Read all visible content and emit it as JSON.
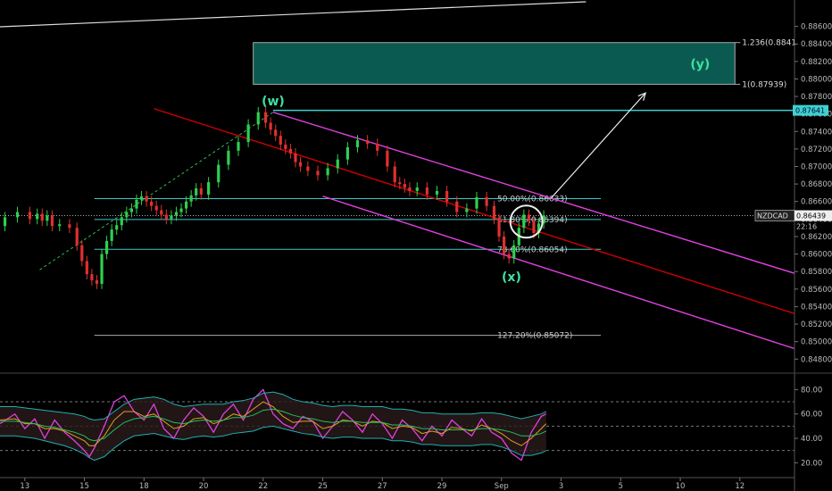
{
  "chart_data": {
    "type": "line",
    "symbol": "NZDCAD",
    "last_price": "0.86439",
    "countdown": "22:16",
    "price_axis": {
      "ylim": [
        0.8466,
        0.8882
      ],
      "ticks": [
        "0.88600",
        "0.88400",
        "0.88200",
        "0.88000",
        "0.87800",
        "0.87600",
        "0.87400",
        "0.87200",
        "0.87000",
        "0.86800",
        "0.86600",
        "0.86400",
        "0.86200",
        "0.86000",
        "0.85800",
        "0.85600",
        "0.85400",
        "0.85200",
        "0.85000",
        "0.84800"
      ],
      "tick_values": [
        0.886,
        0.884,
        0.882,
        0.88,
        0.878,
        0.876,
        0.874,
        0.872,
        0.87,
        0.868,
        0.866,
        0.864,
        0.862,
        0.86,
        0.858,
        0.856,
        0.854,
        0.852,
        0.85,
        0.848
      ]
    },
    "x_axis": {
      "ticks": [
        "13",
        "15",
        "18",
        "20",
        "22",
        "25",
        "27",
        "29",
        "Sep",
        "3",
        "5",
        "10",
        "12"
      ],
      "tick_positions": [
        0,
        12,
        24,
        36,
        48,
        60,
        72,
        84,
        96,
        108,
        120,
        132,
        144
      ],
      "xlim": [
        -5,
        155
      ]
    },
    "wave_labels": [
      {
        "text": "(w)",
        "x": 50,
        "y": 0.877
      },
      {
        "text": "(x)",
        "x": 98,
        "y": 0.8569
      },
      {
        "text": "(y)",
        "x": 136,
        "y": 0.8812
      }
    ],
    "target_box": {
      "x_start": 46,
      "x_end": 143,
      "y_low": 0.87939,
      "y_high": 0.88415,
      "labels": [
        "1.236(0.8841",
        "1(0.87939)"
      ]
    },
    "resistance_level": {
      "value": 0.87641,
      "label": "0.87641"
    },
    "fib_levels": [
      {
        "label": "50.00%(0.86633)",
        "value": 0.86633,
        "x_start": 14,
        "x_end": 116
      },
      {
        "label": "61.80%(0.86394)",
        "value": 0.86394,
        "x_start": 14,
        "x_end": 116
      },
      {
        "label": "78.60%(0.86054)",
        "value": 0.86054,
        "x_start": 14,
        "x_end": 116
      },
      {
        "label": "127.20%(0.85072)",
        "value": 0.85072,
        "x_start": 14,
        "x_end": 116
      }
    ],
    "channel_lines": [
      {
        "color": "#e040e0",
        "points": [
          [
            50,
            0.8762
          ],
          [
            155,
            0.8578
          ]
        ]
      },
      {
        "color": "#e040e0",
        "points": [
          [
            60,
            0.8666
          ],
          [
            155,
            0.8492
          ]
        ]
      },
      {
        "color": "#cc0000",
        "points": [
          [
            26,
            0.8766
          ],
          [
            155,
            0.8532
          ]
        ]
      }
    ],
    "arrow": {
      "from": [
        106,
        0.8664
      ],
      "to": [
        125,
        0.8784
      ]
    },
    "dotted_trend": {
      "from": [
        3,
        0.8582
      ],
      "to": [
        50,
        0.8762
      ]
    },
    "price_series": {
      "x": [
        -5,
        -3,
        0,
        2,
        3,
        4,
        5,
        6,
        8,
        10,
        11,
        12,
        13,
        14,
        15,
        16,
        17,
        18,
        19,
        20,
        21,
        22,
        23,
        24,
        25,
        26,
        27,
        28,
        29,
        30,
        31,
        32,
        33,
        34,
        35,
        36,
        38,
        40,
        42,
        44,
        46,
        48,
        49,
        50,
        51,
        52,
        53,
        54,
        55,
        56,
        58,
        60,
        62,
        64,
        66,
        68,
        70,
        72,
        74,
        75,
        76,
        77,
        78,
        80,
        82,
        84,
        86,
        88,
        90,
        92,
        94,
        95,
        96,
        97,
        98,
        99,
        100,
        101,
        102,
        103,
        104,
        105
      ],
      "y": [
        0.8632,
        0.8642,
        0.8648,
        0.864,
        0.8646,
        0.8638,
        0.8644,
        0.8632,
        0.8634,
        0.863,
        0.861,
        0.8592,
        0.8577,
        0.857,
        0.8566,
        0.86,
        0.8615,
        0.8628,
        0.8633,
        0.8642,
        0.8648,
        0.8652,
        0.8662,
        0.8666,
        0.866,
        0.8655,
        0.865,
        0.8645,
        0.864,
        0.8644,
        0.8648,
        0.8652,
        0.866,
        0.8667,
        0.8675,
        0.8668,
        0.8682,
        0.8702,
        0.8718,
        0.8728,
        0.8748,
        0.8762,
        0.875,
        0.8742,
        0.8735,
        0.8725,
        0.872,
        0.8715,
        0.8705,
        0.87,
        0.8695,
        0.869,
        0.8698,
        0.8708,
        0.8722,
        0.873,
        0.8726,
        0.8718,
        0.87,
        0.8682,
        0.868,
        0.8676,
        0.8672,
        0.8676,
        0.8668,
        0.8672,
        0.866,
        0.8648,
        0.8652,
        0.8665,
        0.8655,
        0.864,
        0.862,
        0.86,
        0.8595,
        0.861,
        0.863,
        0.8645,
        0.8638,
        0.8624,
        0.8635,
        0.8644
      ]
    },
    "oscillator": {
      "ylim": [
        10,
        92
      ],
      "ticks": [
        "80.00",
        "60.00",
        "40.00",
        "20.00"
      ],
      "tick_values": [
        80,
        60,
        40,
        20
      ],
      "levels": [
        70,
        50,
        30
      ],
      "x": [
        -5,
        -2,
        0,
        2,
        4,
        6,
        8,
        10,
        12,
        13,
        14,
        16,
        18,
        20,
        22,
        24,
        26,
        28,
        30,
        32,
        34,
        36,
        38,
        40,
        42,
        44,
        46,
        48,
        50,
        52,
        54,
        56,
        58,
        60,
        62,
        64,
        66,
        68,
        70,
        72,
        74,
        76,
        78,
        80,
        82,
        84,
        86,
        88,
        90,
        92,
        94,
        96,
        98,
        100,
        102,
        104,
        105
      ],
      "series": [
        {
          "name": "rsi",
          "color": "#e040e0",
          "values": [
            52,
            60,
            48,
            56,
            40,
            55,
            45,
            38,
            30,
            25,
            32,
            50,
            70,
            75,
            62,
            55,
            68,
            48,
            40,
            55,
            65,
            58,
            45,
            60,
            68,
            55,
            72,
            80,
            60,
            52,
            48,
            58,
            54,
            40,
            50,
            62,
            55,
            45,
            60,
            52,
            40,
            55,
            48,
            38,
            50,
            42,
            55,
            48,
            42,
            56,
            45,
            40,
            28,
            22,
            45,
            58,
            60
          ]
        },
        {
          "name": "signal",
          "color": "#e0a020",
          "values": [
            55,
            56,
            52,
            52,
            48,
            48,
            46,
            42,
            38,
            34,
            34,
            42,
            55,
            62,
            62,
            58,
            60,
            54,
            48,
            50,
            56,
            57,
            52,
            55,
            60,
            58,
            64,
            70,
            66,
            58,
            53,
            54,
            54,
            48,
            50,
            55,
            54,
            50,
            54,
            53,
            48,
            50,
            49,
            44,
            46,
            44,
            49,
            48,
            46,
            51,
            48,
            44,
            38,
            34,
            40,
            48,
            52
          ]
        },
        {
          "name": "ema",
          "color": "#20c060",
          "values": [
            54,
            54,
            53,
            52,
            50,
            49,
            47,
            45,
            42,
            39,
            38,
            40,
            47,
            53,
            56,
            57,
            58,
            56,
            53,
            52,
            54,
            55,
            54,
            55,
            57,
            57,
            59,
            63,
            64,
            62,
            59,
            57,
            56,
            54,
            53,
            54,
            54,
            53,
            53,
            53,
            51,
            51,
            50,
            48,
            48,
            47,
            47,
            47,
            47,
            48,
            48,
            47,
            45,
            42,
            42,
            44,
            46
          ]
        },
        {
          "name": "band_upper",
          "color": "#20b0b0",
          "values": [
            66,
            66,
            65,
            64,
            63,
            62,
            61,
            60,
            58,
            56,
            55,
            56,
            62,
            68,
            72,
            73,
            74,
            72,
            68,
            66,
            67,
            68,
            68,
            68,
            70,
            71,
            73,
            77,
            78,
            76,
            72,
            70,
            69,
            67,
            66,
            67,
            67,
            66,
            66,
            66,
            64,
            64,
            63,
            61,
            61,
            60,
            60,
            60,
            60,
            61,
            61,
            60,
            58,
            56,
            58,
            60,
            62
          ]
        },
        {
          "name": "band_lower",
          "color": "#20b0b0",
          "values": [
            42,
            42,
            41,
            40,
            38,
            36,
            34,
            31,
            27,
            24,
            22,
            25,
            32,
            38,
            42,
            43,
            44,
            42,
            40,
            39,
            41,
            42,
            41,
            42,
            44,
            45,
            46,
            49,
            50,
            48,
            46,
            44,
            43,
            41,
            40,
            41,
            41,
            40,
            40,
            40,
            38,
            38,
            37,
            35,
            35,
            34,
            34,
            34,
            34,
            35,
            35,
            33,
            30,
            26,
            26,
            28,
            30
          ]
        }
      ]
    }
  }
}
